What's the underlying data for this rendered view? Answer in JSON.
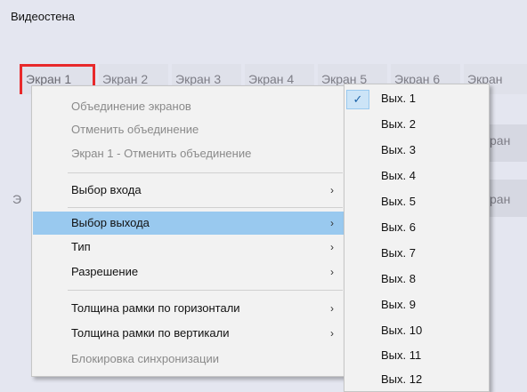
{
  "window": {
    "title": "Видеостена"
  },
  "screens": [
    "Экран 1",
    "Экран 2",
    "Экран 3",
    "Экран 4",
    "Экран 5",
    "Экран 6",
    "Экран"
  ],
  "background_partial": {
    "right_row2": "ран",
    "right_row3": "ран",
    "left_row3": "Э"
  },
  "context_menu": {
    "items": [
      {
        "label": "Объединение экранов",
        "disabled": true,
        "submenu": false
      },
      {
        "label": "Отменить объединение",
        "disabled": true,
        "submenu": false
      },
      {
        "label": "Экран 1 - Отменить объединение",
        "disabled": true,
        "submenu": false
      },
      {
        "label": "Выбор входа",
        "disabled": false,
        "submenu": true
      },
      {
        "label": "Выбор выхода",
        "disabled": false,
        "submenu": true,
        "highlighted": true
      },
      {
        "label": "Тип",
        "disabled": false,
        "submenu": true
      },
      {
        "label": "Разрешение",
        "disabled": false,
        "submenu": true
      },
      {
        "label": "Толщина рамки по горизонтали",
        "disabled": false,
        "submenu": true
      },
      {
        "label": "Толщина рамки по вертикали",
        "disabled": false,
        "submenu": true
      },
      {
        "label": "Блокировка синхронизации",
        "disabled": true,
        "submenu": false
      }
    ],
    "chevron": "›"
  },
  "output_submenu": {
    "checked_index": 0,
    "check_icon": "✓",
    "items": [
      "Вых. 1",
      "Вых. 2",
      "Вых. 3",
      "Вых. 4",
      "Вых. 5",
      "Вых. 6",
      "Вых. 7",
      "Вых. 8",
      "Вых. 9",
      "Вых. 10",
      "Вых. 11",
      "Вых. 12"
    ]
  },
  "colors": {
    "selection_border": "#e8292b",
    "highlight": "#99c9ef"
  }
}
